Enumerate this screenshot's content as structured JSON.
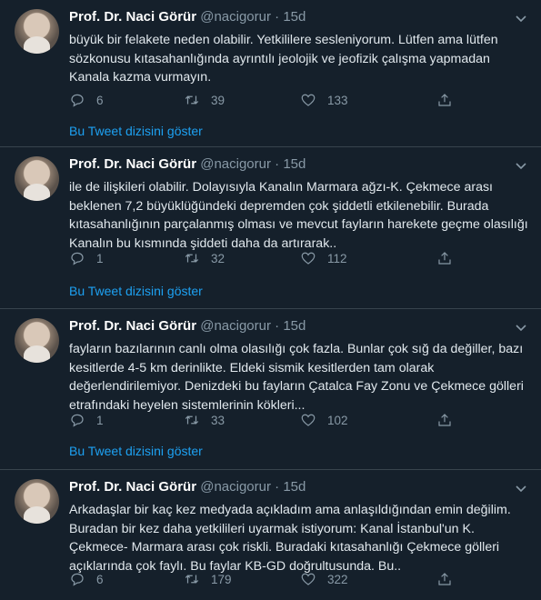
{
  "tweets": [
    {
      "name": "Prof. Dr. Naci Görür",
      "handle": "@nacigorur",
      "separator": "·",
      "time": "15d",
      "text": "büyük bir felakete neden olabilir. Yetkililere sesleniyorum. Lütfen ama lütfen sözkonusu kıtasahanlığında ayrıntılı jeolojik ve jeofizik çalışma yapmadan Kanala kazma vurmayın.",
      "replies": "6",
      "retweets": "39",
      "likes": "133",
      "show_thread": "Bu Tweet dizisini göster"
    },
    {
      "name": "Prof. Dr. Naci Görür",
      "handle": "@nacigorur",
      "separator": "·",
      "time": "15d",
      "text": "ile de ilişkileri olabilir. Dolayısıyla Kanalın Marmara ağzı-K. Çekmece arası beklenen 7,2 büyüklüğündeki depremden çok şiddetli etkilenebilir. Burada kıtasahanlığının parçalanmış olması ve mevcut fayların harekete geçme olasılığı Kanalın bu kısmında şiddeti daha da artırarak..",
      "replies": "1",
      "retweets": "32",
      "likes": "112",
      "show_thread": "Bu Tweet dizisini göster"
    },
    {
      "name": "Prof. Dr. Naci Görür",
      "handle": "@nacigorur",
      "separator": "·",
      "time": "15d",
      "text": "fayların bazılarının canlı olma olasılığı çok fazla. Bunlar çok sığ da değiller, bazı kesitlerde 4-5 km derinlikte. Eldeki sismik kesitlerden tam olarak değerlendirilemiyor. Denizdeki bu fayların Çatalca Fay Zonu ve Çekmece gölleri etrafındaki heyelen sistemlerinin kökleri...",
      "replies": "1",
      "retweets": "33",
      "likes": "102",
      "show_thread": "Bu Tweet dizisini göster"
    },
    {
      "name": "Prof. Dr. Naci Görür",
      "handle": "@nacigorur",
      "separator": "·",
      "time": "15d",
      "text": "Arkadaşlar bir kaç kez medyada açıkladım ama anlaşıldığından emin değilim. Buradan bir kez daha yetkilileri uyarmak istiyorum: Kanal İstanbul'un K. Çekmece- Marmara arası çok riskli. Buradaki kıtasahanlığı Çekmece gölleri açıklarında çok faylı. Bu faylar KB-GD doğrultusunda. Bu..",
      "replies": "6",
      "retweets": "179",
      "likes": "322",
      "show_thread": ""
    }
  ]
}
